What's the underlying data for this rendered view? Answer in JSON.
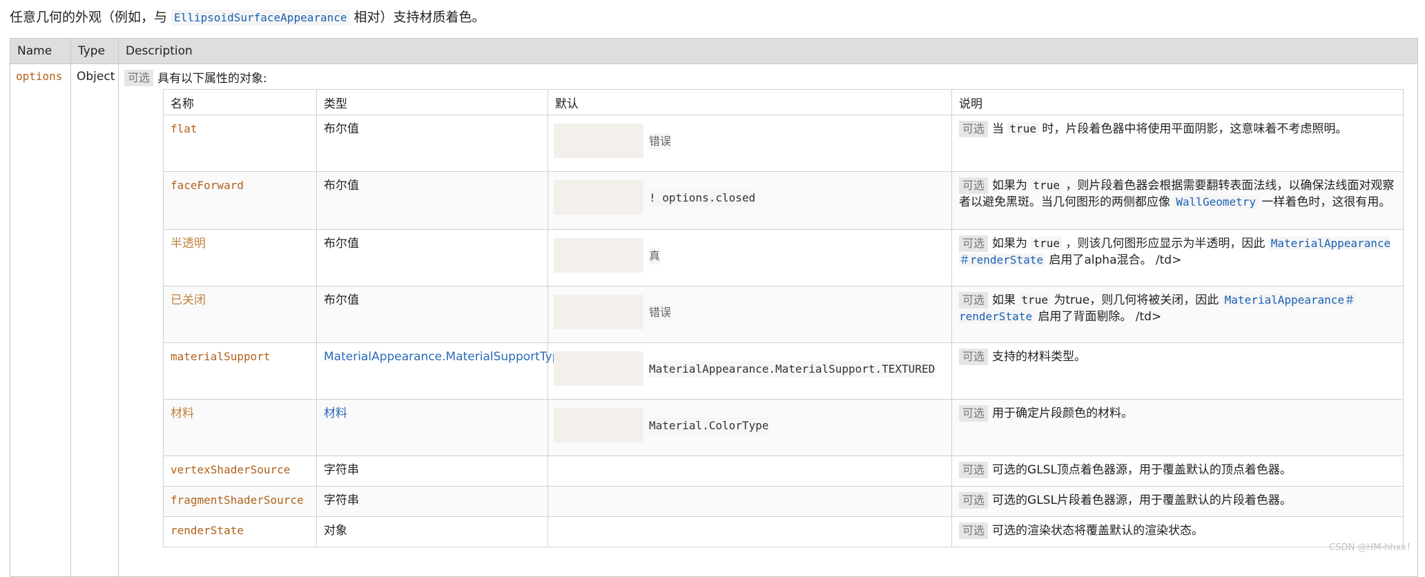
{
  "intro": {
    "before": "任意几何的外观（例如，与 ",
    "code": "EllipsoidSurfaceAppearance",
    "after": " 相对）支持材质着色。"
  },
  "outer_headers": {
    "name": "Name",
    "type": "Type",
    "description": "Description"
  },
  "param": {
    "name": "options",
    "type": "Object",
    "badge": "可选",
    "description": "具有以下属性的对象:"
  },
  "inner_headers": {
    "name": "名称",
    "type": "类型",
    "default": "默认",
    "desc": "说明"
  },
  "rows": [
    {
      "name": "flat",
      "type": "布尔值",
      "default": "错误",
      "badge": "可选",
      "desc_parts": [
        "当 ",
        "true",
        " 时，片段着色器中将使用平面阴影，这意味着不考虑照明。"
      ]
    },
    {
      "name": "faceForward",
      "type": "布尔值",
      "default": "! options.closed",
      "badge": "可选",
      "desc_parts": [
        "如果为 ",
        "true",
        " ，则片段着色器会根据需要翻转表面法线，以确保法线面对观察者以避免黑斑。当几何图形的两侧都应像 ",
        "WallGeometry",
        " 一样着色时，这很有用。"
      ]
    },
    {
      "name": "半透明",
      "type": "布尔值",
      "default": "真",
      "badge": "可选",
      "desc_parts": [
        "如果为 ",
        "true",
        " ，则该几何图形应显示为半透明，因此 ",
        "MaterialAppearance＃renderState",
        " 启用了alpha混合。 /td>"
      ]
    },
    {
      "name": "已关闭",
      "type": "布尔值",
      "default": "错误",
      "badge": "可选",
      "desc_parts": [
        "如果 ",
        "true",
        " 为true，则几何将被关闭，因此 ",
        "MaterialAppearance＃renderState",
        " 启用了背面剔除。 /td>"
      ]
    },
    {
      "name": "materialSupport",
      "type": "MaterialAppearance.MaterialSupportType",
      "default": "MaterialAppearance.MaterialSupport.TEXTURED",
      "badge": "可选",
      "desc_parts": [
        "支持的材料类型。"
      ]
    },
    {
      "name": "材料",
      "type": "材料",
      "default": "Material.ColorType",
      "badge": "可选",
      "desc_parts": [
        "用于确定片段颜色的材料。"
      ]
    },
    {
      "name": "vertexShaderSource",
      "type": "字符串",
      "default": "",
      "badge": "可选",
      "desc_parts": [
        "可选的GLSL顶点着色器源，用于覆盖默认的顶点着色器。"
      ]
    },
    {
      "name": "fragmentShaderSource",
      "type": "字符串",
      "default": "",
      "badge": "可选",
      "desc_parts": [
        "可选的GLSL片段着色器源，用于覆盖默认的片段着色器。"
      ]
    },
    {
      "name": "renderState",
      "type": "对象",
      "default": "",
      "badge": "可选",
      "desc_parts": [
        "可选的渲染状态将覆盖默认的渲染状态。"
      ]
    }
  ],
  "watermark": "CSDN @HM-hhxx！"
}
